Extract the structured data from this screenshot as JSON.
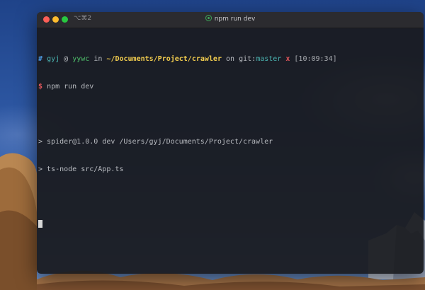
{
  "window": {
    "shortcut": "⌥⌘2",
    "title": "npm run dev",
    "title_icon": "node-icon"
  },
  "prompt": {
    "hash": "#",
    "user": "gyj",
    "at": "@",
    "host": "yywc",
    "in": "in",
    "path": "~/Documents/Project/crawler",
    "on": "on",
    "git_label": "git:",
    "branch": "master",
    "dirty": "x",
    "time": "[10:09:34]"
  },
  "command": {
    "symbol": "$",
    "text": "npm run dev"
  },
  "output": [
    "> spider@1.0.0 dev /Users/gyj/Documents/Project/crawler",
    "> ts-node src/App.ts"
  ],
  "colors": {
    "user": "#4e9ce5",
    "host": "#4ab3b0",
    "path": "#f1cc4e",
    "branch": "#4fbf6b",
    "dirty": "#e0565b",
    "command_symbol": "#e0565b"
  }
}
